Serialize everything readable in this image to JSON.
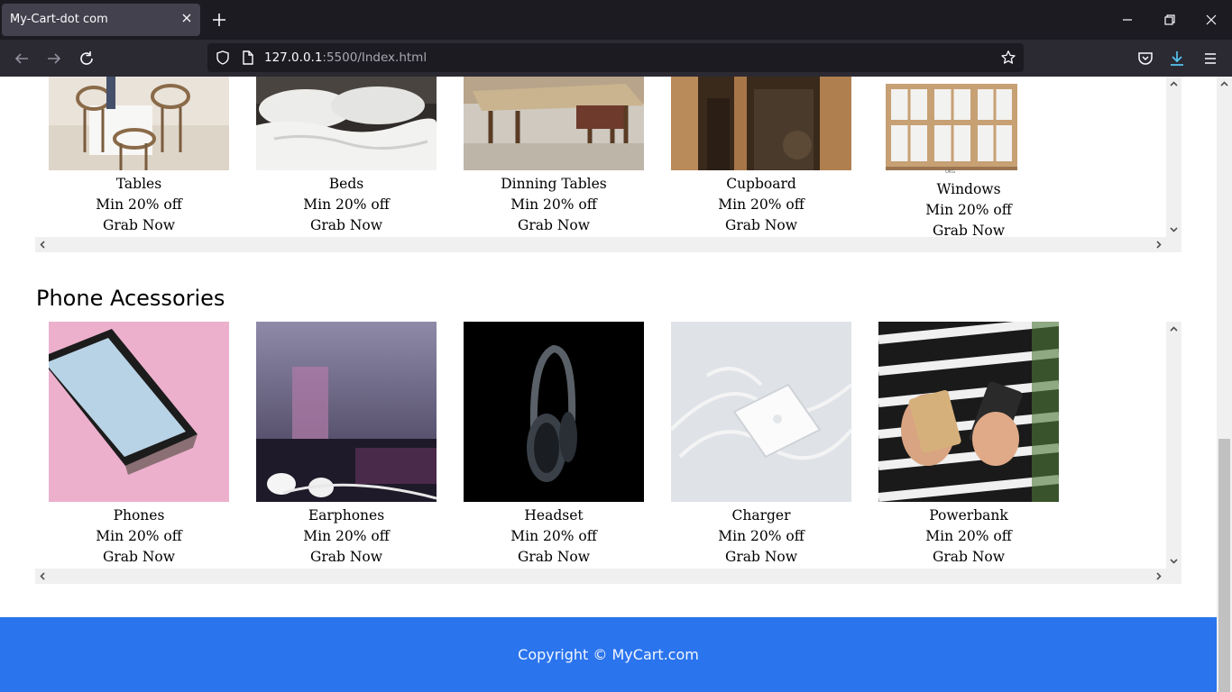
{
  "browser": {
    "tab_title": "My-Cart-dot com",
    "url_host": "127.0.0.1",
    "url_rest": ":5500/Index.html"
  },
  "furniture": {
    "items": [
      {
        "name": "Tables",
        "deal": "Min 20% off",
        "cta": "Grab Now"
      },
      {
        "name": "Beds",
        "deal": "Min 20% off",
        "cta": "Grab Now"
      },
      {
        "name": "Dinning Tables",
        "deal": "Min 20% off",
        "cta": "Grab Now"
      },
      {
        "name": "Cupboard",
        "deal": "Min 20% off",
        "cta": "Grab Now"
      },
      {
        "name": "Windows",
        "deal": "Min 20% off",
        "cta": "Grab Now",
        "image_caption": "OKG"
      }
    ]
  },
  "phone_accessories": {
    "title": "Phone Acessories",
    "items": [
      {
        "name": "Phones",
        "deal": "Min 20% off",
        "cta": "Grab Now"
      },
      {
        "name": "Earphones",
        "deal": "Min 20% off",
        "cta": "Grab Now"
      },
      {
        "name": "Headset",
        "deal": "Min 20% off",
        "cta": "Grab Now"
      },
      {
        "name": "Charger",
        "deal": "Min 20% off",
        "cta": "Grab Now"
      },
      {
        "name": "Powerbank",
        "deal": "Min 20% off",
        "cta": "Grab Now"
      }
    ]
  },
  "footer": {
    "text": "Copyright © MyCart.com"
  },
  "colors": {
    "footer_bg": "#2a74ee",
    "chrome_dark": "#1c1b22",
    "download_accent": "#54c6f2"
  }
}
